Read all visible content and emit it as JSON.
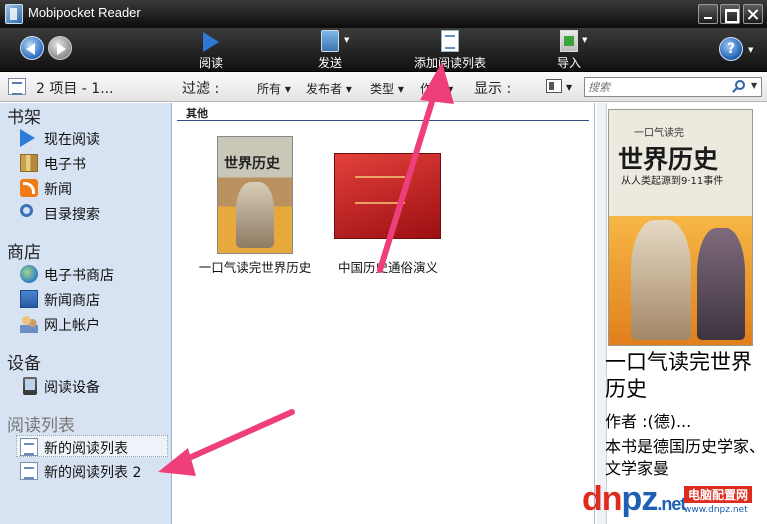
{
  "app": {
    "title": "Mobipocket Reader"
  },
  "toolbar": {
    "read_label": "阅读",
    "send_label": "发送",
    "add_list_label": "添加阅读列表",
    "import_label": "导入",
    "help_label": "?"
  },
  "filterbar": {
    "count_text": "2 项目 - 1...",
    "filter_label": "过滤 :",
    "filter_all": "所有",
    "filter_publisher": "发布者",
    "filter_type": "类型",
    "filter_author": "作...",
    "display_label": "显示 :",
    "search_placeholder": "搜索"
  },
  "sidebar": {
    "bookshelf": {
      "heading": "书架",
      "items": [
        "现在阅读",
        "电子书",
        "新闻",
        "目录搜索"
      ]
    },
    "store": {
      "heading": "商店",
      "items": [
        "电子书商店",
        "新闻商店",
        "网上帐户"
      ]
    },
    "devices": {
      "heading": "设备",
      "items": [
        "阅读设备"
      ]
    },
    "reading_lists": {
      "heading": "阅读列表",
      "items": [
        "新的阅读列表",
        "新的阅读列表 2"
      ]
    }
  },
  "main": {
    "group_heading": "其他",
    "books": [
      {
        "title": "一口气读完世界历史",
        "cover_title": "世界历史"
      },
      {
        "title": "中国历史通俗演义"
      }
    ]
  },
  "preview": {
    "cover_small": "一口气读完",
    "cover_title": "世界历史",
    "cover_sub": "从人类起源到9·11事件",
    "title": "一口气读完世界历史",
    "author": "作者 :(德)...",
    "description": "本书是德国历史学家、文学家曼"
  },
  "watermark": {
    "logo_text_red": "dn",
    "logo_text_blue": "pz",
    "logo_suffix": ".net",
    "tag": "电脑配置网",
    "url": "www.dnpz.net"
  },
  "colors": {
    "accent": "#2e7bd8",
    "arrow": "#ef3f7a",
    "sidebar_bg": "#d7e3f3"
  }
}
